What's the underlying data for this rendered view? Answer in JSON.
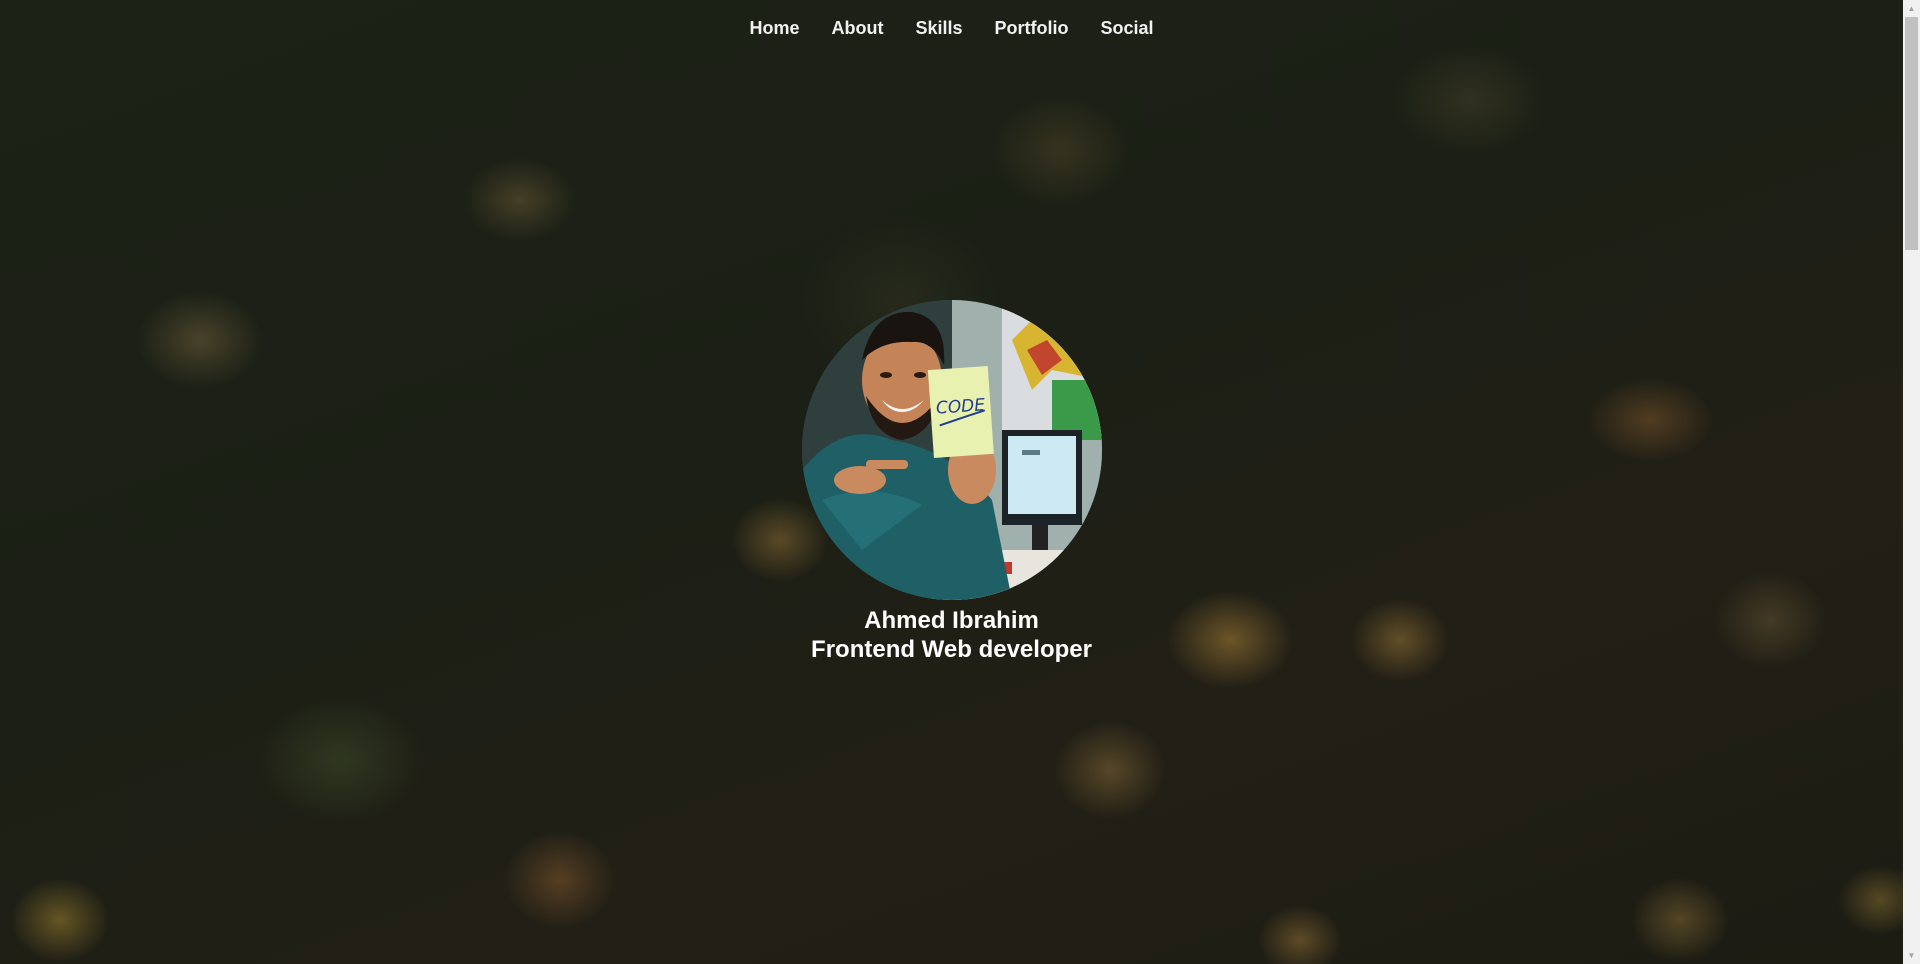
{
  "nav": {
    "items": [
      {
        "label": "Home"
      },
      {
        "label": "About"
      },
      {
        "label": "Skills"
      },
      {
        "label": "Portfolio"
      },
      {
        "label": "Social"
      }
    ]
  },
  "hero": {
    "avatar_note_text": "CODE",
    "name": "Ahmed Ibrahim",
    "role": "Frontend Web developer"
  },
  "scrollbar": {
    "up_icon": "triangle-up-icon",
    "down_icon": "triangle-down-icon"
  },
  "colors": {
    "nav_text": "#f2f2f2",
    "hero_text": "#ffffff",
    "background": "#1b1f15"
  }
}
